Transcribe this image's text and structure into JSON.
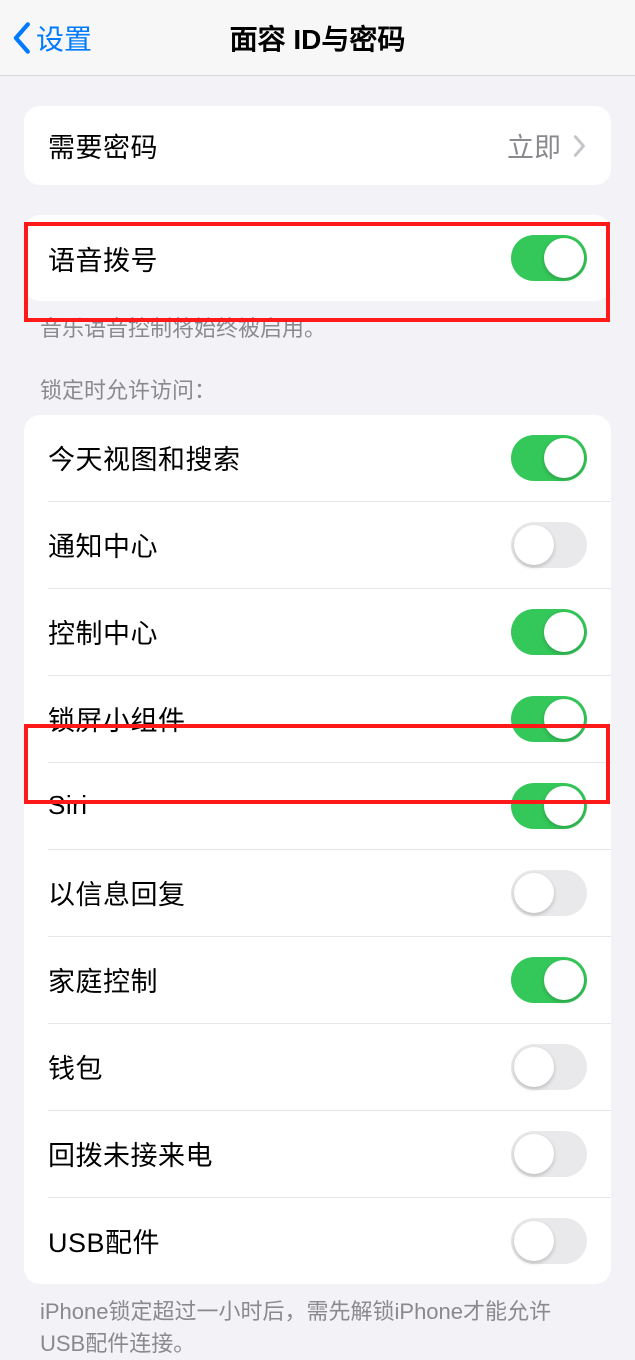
{
  "nav": {
    "back": "设置",
    "title": "面容 ID与密码"
  },
  "require_passcode": {
    "label": "需要密码",
    "value": "立即"
  },
  "voice_dial": {
    "label": "语音拨号",
    "on": true,
    "footer": "音乐语音控制将始终被启用。"
  },
  "lock_header": "锁定时允许访问：",
  "lock_items": [
    {
      "label": "今天视图和搜索",
      "on": true
    },
    {
      "label": "通知中心",
      "on": false
    },
    {
      "label": "控制中心",
      "on": true
    },
    {
      "label": "锁屏小组件",
      "on": true
    },
    {
      "label": "Siri",
      "on": true
    },
    {
      "label": "以信息回复",
      "on": false
    },
    {
      "label": "家庭控制",
      "on": true
    },
    {
      "label": "钱包",
      "on": false
    },
    {
      "label": "回拨未接来电",
      "on": false
    },
    {
      "label": "USB配件",
      "on": false
    }
  ],
  "usb_footer": "iPhone锁定超过一小时后，需先解锁iPhone才能允许USB配件连接。"
}
